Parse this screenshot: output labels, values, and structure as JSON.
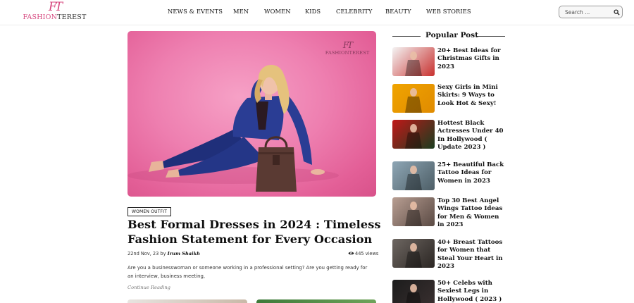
{
  "header": {
    "logo": {
      "mark": "FT",
      "text_pink": "FASHION",
      "text_dark": "TEREST"
    },
    "nav": [
      "NEWS & EVENTS",
      "MEN",
      "WOMEN",
      "KIDS",
      "CELEBRITY",
      "BEAUTY",
      "WEB STORIES"
    ],
    "search": {
      "placeholder": "Search ..."
    }
  },
  "hero": {
    "watermark": {
      "mark": "FT",
      "text": "FASHIONTEREST"
    }
  },
  "article": {
    "category": "WOMEN OUTFIT",
    "title_lines": [
      "Best Formal Dresses in 2024 : Timeless",
      "Fashion Statement for Every Occasion"
    ],
    "date": "22nd Nov, 23 by",
    "author": "Irum Shaikh",
    "views": "445 views",
    "excerpt_lines": [
      "Are you a businesswoman or someone working in a professional setting? Are you getting ready for",
      "an interview, business meeting,"
    ],
    "continue_label": "Continue Reading"
  },
  "sidebar": {
    "title": "Popular Post",
    "posts": [
      {
        "lines": [
          "20+ Best Ideas for",
          "Christmas Gifts in",
          "2023"
        ],
        "thumb_colors": [
          "#f4f4f4",
          "#c8312f"
        ]
      },
      {
        "lines": [
          "Sexy Girls in Mini",
          "Skirts: 9 Ways to",
          "Look Hot & Sexy!"
        ],
        "thumb_colors": [
          "#f0a400",
          "#e08b00"
        ]
      },
      {
        "lines": [
          "Hottest Black",
          "Actresses Under 40",
          "In Hollywood (",
          "Update 2023 )"
        ],
        "thumb_colors": [
          "#c01818",
          "#1a3d1f"
        ]
      },
      {
        "lines": [
          "25+ Beautiful Back",
          "Tattoo Ideas for",
          "Women in 2023"
        ],
        "thumb_colors": [
          "#8ea6b5",
          "#4d5e66"
        ]
      },
      {
        "lines": [
          "Top 30 Best Angel",
          "Wings Tattoo Ideas",
          "for Men & Women",
          "in 2023"
        ],
        "thumb_colors": [
          "#b89e92",
          "#5a4a44"
        ]
      },
      {
        "lines": [
          "40+ Breast Tattoos",
          "for Women that",
          "Steal Your Heart in",
          "2023"
        ],
        "thumb_colors": [
          "#6d6661",
          "#2b2623"
        ]
      },
      {
        "lines": [
          "50+ Celebs with",
          "Sexiest Legs in",
          "Hollywood ( 2023 )"
        ],
        "thumb_colors": [
          "#1c1c1c",
          "#3a3030"
        ]
      }
    ]
  },
  "colors": {
    "brand_pink": "#d6477e",
    "hero_pink": "#ee7fb0"
  }
}
